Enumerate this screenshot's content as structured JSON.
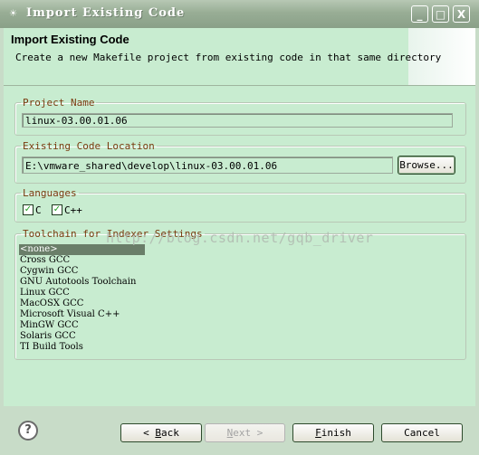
{
  "window": {
    "title": "Import Existing Code",
    "icon": "eclipse-icon"
  },
  "title_buttons": {
    "minimize": "_",
    "maximize": "□",
    "close": "X"
  },
  "header": {
    "title": "Import Existing Code",
    "description": "Create a new Makefile project from existing code in that same directory"
  },
  "project_name": {
    "legend": "Project Name",
    "value": "linux-03.00.01.06"
  },
  "code_location": {
    "legend": "Existing Code Location",
    "value": "E:\\vmware_shared\\develop\\linux-03.00.01.06",
    "browse_label": "Browse..."
  },
  "languages": {
    "legend": "Languages",
    "items": [
      {
        "label": "C",
        "checked": true
      },
      {
        "label": "C++",
        "checked": true
      }
    ]
  },
  "toolchain": {
    "legend": "Toolchain for Indexer Settings",
    "selected": "<none>",
    "items": [
      "<none>",
      "Cross GCC",
      "Cygwin GCC",
      "GNU Autotools Toolchain",
      "Linux GCC",
      "MacOSX GCC",
      "Microsoft Visual C++",
      "MinGW GCC",
      "Solaris GCC",
      "TI Build Tools"
    ]
  },
  "watermark": "http://blog.csdn.net/gqb_driver",
  "footer": {
    "help_icon": "?",
    "back_mnemonic": "B",
    "back_rest": "ack",
    "next_mnemonic": "N",
    "next_rest": "ext >",
    "finish_mnemonic": "F",
    "finish_rest": "inish",
    "cancel_label": "Cancel"
  }
}
